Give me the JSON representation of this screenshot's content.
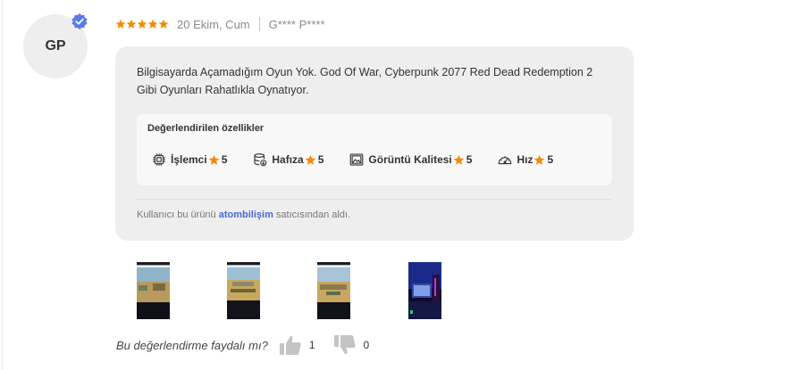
{
  "review": {
    "avatar_initials": "GP",
    "rating": 5,
    "date": "20 Ekim, Cum",
    "reviewer": "G**** P****",
    "text": "Bilgisayarda Açamadığım Oyun Yok. God Of War, Cyberpunk 2077 Red Dead Redemption 2 Gibi Oyunları Rahatlıkla Oynatıyor.",
    "features_title": "Değerlendirilen özellikler",
    "features": [
      {
        "label": "İşlemci",
        "score": "5",
        "icon": "cpu-icon"
      },
      {
        "label": "Hafıza",
        "score": "5",
        "icon": "memory-icon"
      },
      {
        "label": "Görüntü Kalitesi",
        "score": "5",
        "icon": "image-quality-icon"
      },
      {
        "label": "Hız",
        "score": "5",
        "icon": "speedometer-icon"
      }
    ],
    "seller_prefix": "Kullanıcı bu ürünü",
    "seller_name": "atombilişim",
    "seller_suffix": "satıcısından aldı."
  },
  "helpful": {
    "question": "Bu değerlendirme faydalı mı?",
    "likes": "1",
    "dislikes": "0"
  },
  "colors": {
    "star": "#f28b00",
    "verified": "#5b7be8",
    "seller_link": "#4a68d8",
    "bubble": "#eeeeef"
  }
}
